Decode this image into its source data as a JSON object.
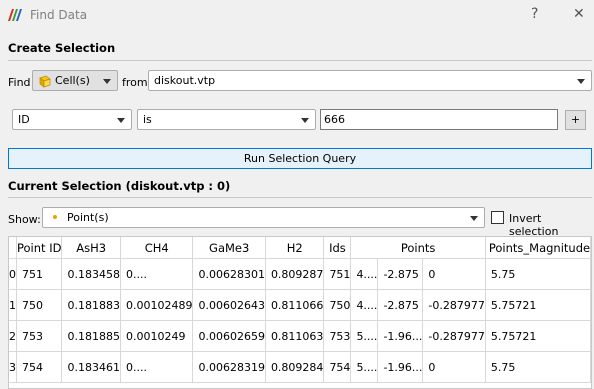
{
  "window": {
    "title": "Find Data",
    "help": "?",
    "close": "✕"
  },
  "create_selection": {
    "heading": "Create Selection",
    "find_label": "Find",
    "find_value": "Cell(s)",
    "from_label": "from",
    "from_value": "diskout.vtp",
    "query_field": "ID",
    "query_op": "is",
    "query_value": "666",
    "add_label": "+",
    "run_label": "Run Selection Query"
  },
  "current_selection": {
    "heading": "Current Selection (diskout.vtp : 0)",
    "show_label": "Show:",
    "show_value": "Point(s)",
    "invert_label": "Invert selection"
  },
  "table": {
    "headers": [
      "Point ID",
      "AsH3",
      "CH4",
      "GaMe3",
      "H2",
      "Ids",
      "Points",
      "Points_Magnitude"
    ],
    "rows": [
      {
        "idx": "0",
        "cells": [
          "751",
          "0.183458",
          "0....",
          "0.00628301",
          "0.809287",
          "751",
          "4....",
          "-2.875",
          "0",
          "5.75"
        ]
      },
      {
        "idx": "1",
        "cells": [
          "750",
          "0.181883",
          "0.00102489",
          "0.00602643",
          "0.811066",
          "750",
          "4....",
          "-2.875",
          "-0.287977",
          "5.75721"
        ]
      },
      {
        "idx": "2",
        "cells": [
          "753",
          "0.181885",
          "0.0010249",
          "0.00602659",
          "0.811063",
          "753",
          "5....",
          "-1.96...",
          "-0.287977",
          "5.75721"
        ]
      },
      {
        "idx": "3",
        "cells": [
          "754",
          "0.183461",
          "0....",
          "0.00628319",
          "0.809284",
          "754",
          "5....",
          "-1.96...",
          "0",
          "5.75"
        ]
      }
    ]
  },
  "colors": {
    "accent": "#0078d7",
    "icon_red": "#d62d20",
    "icon_green": "#3a9d3a",
    "icon_blue": "#2266cc"
  }
}
